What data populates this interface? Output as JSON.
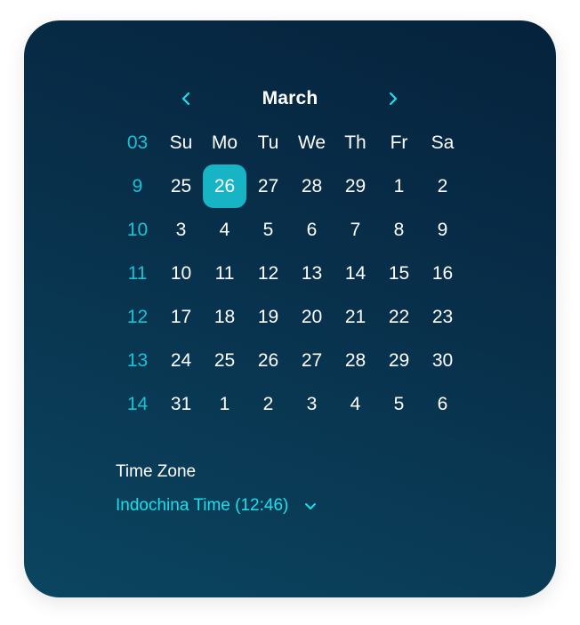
{
  "calendar": {
    "month": "March",
    "week_header": "03",
    "weekdays": [
      "Su",
      "Mo",
      "Tu",
      "We",
      "Th",
      "Fr",
      "Sa"
    ],
    "weeks": [
      {
        "week": "9",
        "days": [
          "25",
          "26",
          "27",
          "28",
          "29",
          "1",
          "2"
        ]
      },
      {
        "week": "10",
        "days": [
          "3",
          "4",
          "5",
          "6",
          "7",
          "8",
          "9"
        ]
      },
      {
        "week": "11",
        "days": [
          "10",
          "11",
          "12",
          "13",
          "14",
          "15",
          "16"
        ]
      },
      {
        "week": "12",
        "days": [
          "17",
          "18",
          "19",
          "20",
          "21",
          "22",
          "23"
        ]
      },
      {
        "week": "13",
        "days": [
          "24",
          "25",
          "26",
          "27",
          "28",
          "29",
          "30"
        ]
      },
      {
        "week": "14",
        "days": [
          "31",
          "1",
          "2",
          "3",
          "4",
          "5",
          "6"
        ]
      }
    ],
    "selected": {
      "week_index": 0,
      "day_index": 1
    }
  },
  "timezone": {
    "label": "Time Zone",
    "value": "Indochina Time (12:46)"
  },
  "colors": {
    "accent": "#17c4d6",
    "selected_bg": "#16b4c4",
    "tz_value": "#1ae0ec",
    "card_top": "#06223c",
    "card_bottom": "#0b4560"
  },
  "icons": {
    "prev": "chevron-left-icon",
    "next": "chevron-right-icon",
    "dropdown": "chevron-down-icon"
  }
}
